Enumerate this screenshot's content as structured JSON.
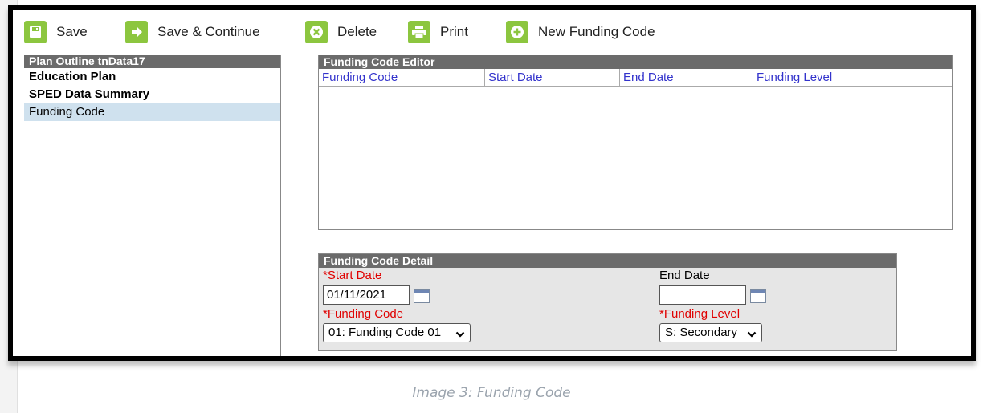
{
  "toolbar": {
    "save": "Save",
    "save_continue": "Save & Continue",
    "delete": "Delete",
    "print": "Print",
    "new_funding_code": "New Funding Code"
  },
  "outline": {
    "header": "Plan Outline tnData17",
    "items": [
      "Education Plan",
      "SPED Data Summary",
      "Funding Code"
    ],
    "selected": "Funding Code"
  },
  "editor": {
    "header": "Funding Code Editor",
    "columns": [
      "Funding Code",
      "Start Date",
      "End Date",
      "Funding Level"
    ],
    "rows": []
  },
  "detail": {
    "header": "Funding Code Detail",
    "start_date_label": "*Start Date",
    "start_date_value": "01/11/2021",
    "end_date_label": "End Date",
    "end_date_value": "",
    "funding_code_label": "*Funding Code",
    "funding_code_value": "01: Funding Code 01",
    "funding_level_label": "*Funding Level",
    "funding_level_value": "S: Secondary"
  },
  "caption": "Image 3: Funding Code",
  "colors": {
    "accent_green": "#8cc63f",
    "panel_header": "#6b6b6b",
    "selected_row": "#cfe1ee",
    "column_link": "#3333cc",
    "required": "#e00000"
  }
}
